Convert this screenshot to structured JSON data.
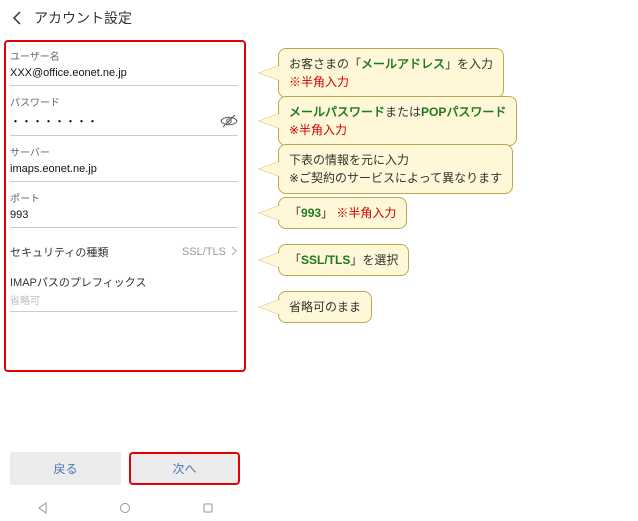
{
  "header": {
    "title": "アカウント設定"
  },
  "form": {
    "username_label": "ユーザー名",
    "username_value": "XXX@office.eonet.ne.jp",
    "password_label": "パスワード",
    "password_value": "・・・・・・・・",
    "server_label": "サーバー",
    "server_value": "imaps.eonet.ne.jp",
    "port_label": "ポート",
    "port_value": "993",
    "security_label": "セキュリティの種類",
    "security_value": "SSL/TLS",
    "imap_prefix_label": "IMAPパスのプレフィックス",
    "imap_prefix_placeholder": "省略可"
  },
  "buttons": {
    "back": "戻る",
    "next": "次へ"
  },
  "callouts": {
    "c1": {
      "t1": "お客さまの「",
      "t2": "メールアドレス",
      "t3": "」を入力",
      "t4": "※半角入力"
    },
    "c2": {
      "t1": "メールパスワード",
      "t2": "または",
      "t3": "POPパスワード",
      "t4": "※半角入力"
    },
    "c3": {
      "t1": "下表の情報を元に入力",
      "t2": "※ご契約のサービスによって異なります"
    },
    "c4": {
      "t1": "「",
      "t2": "993",
      "t3": "」 ",
      "t4": "※半角入力"
    },
    "c5": {
      "t1": "「",
      "t2": "SSL/TLS",
      "t3": "」を選択"
    },
    "c6": {
      "t1": "省略可のまま"
    }
  }
}
